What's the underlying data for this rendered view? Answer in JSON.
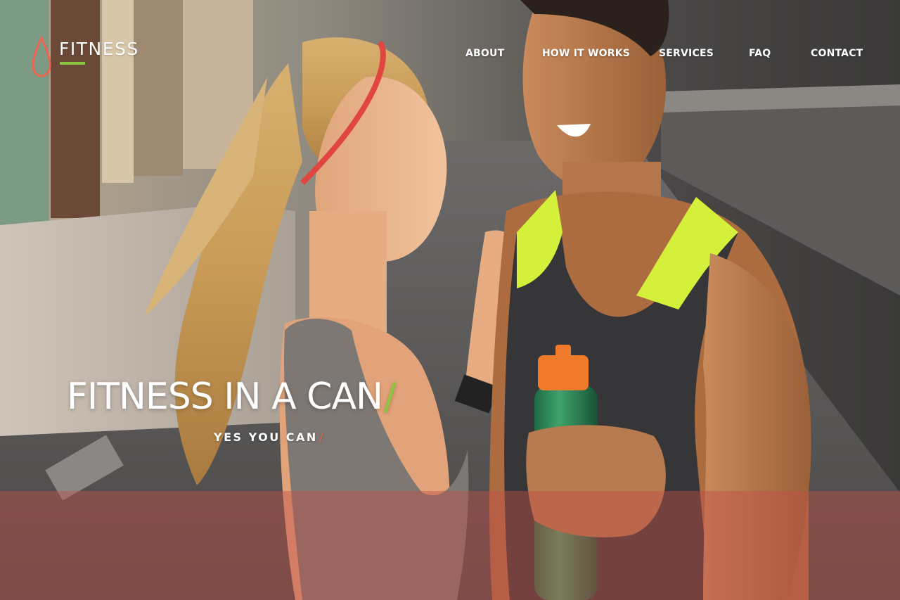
{
  "brand": {
    "name": "FITNESS",
    "accent_green": "#8cc63f",
    "accent_red": "#f0634f",
    "logo_icon": "water-drop-icon"
  },
  "nav": {
    "items": [
      {
        "label": "ABOUT"
      },
      {
        "label": "HOW IT WORKS"
      },
      {
        "label": "SERVICES"
      },
      {
        "label": "FAQ"
      },
      {
        "label": "CONTACT"
      }
    ]
  },
  "hero": {
    "headline": "FITNESS IN A CAN",
    "headline_slash": "/",
    "tagline": "YES YOU CAN",
    "tagline_slash": "/",
    "band_color": "#c0504a"
  }
}
